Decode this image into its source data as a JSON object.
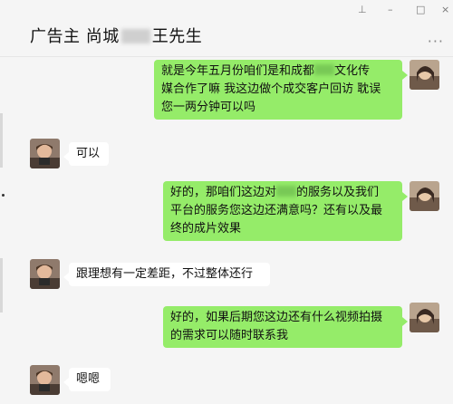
{
  "header": {
    "title_prefix": "广告主 尚城",
    "title_suffix": "王先生",
    "pin_icon": "pin-icon",
    "minimize_icon": "minimize-icon",
    "maximize_icon": "maximize-icon",
    "close_icon": "close-icon",
    "more_icon": "more-icon",
    "window_controls": [
      "⊥",
      "–",
      "□",
      "×"
    ],
    "more_label": "···"
  },
  "messages": [
    {
      "sender": "me",
      "lines": [
        "就是今年五月份咱们是和成都",
        "文化传",
        "媒合作了嘛 我这边做个成交客户回访 耽误",
        "您一两分钟可以吗"
      ]
    },
    {
      "sender": "other",
      "lines": [
        "可以"
      ]
    },
    {
      "sender": "me",
      "lines": [
        "好的，那咱们这边对",
        "的服务以及我们",
        "平台的服务您这边还满意吗？还有以及最",
        "终的成片效果"
      ]
    },
    {
      "sender": "other",
      "lines": [
        "跟理想有一定差距，不过整体还行"
      ]
    },
    {
      "sender": "me",
      "lines": [
        "好的，如果后期您这边还有什么视频拍摄",
        "的需求可以随时联系我"
      ]
    },
    {
      "sender": "other",
      "lines": [
        "嗯嗯"
      ]
    }
  ],
  "colors": {
    "my_bubble": "#95ec69",
    "other_bubble": "#ffffff",
    "background": "#f5f5f5"
  }
}
